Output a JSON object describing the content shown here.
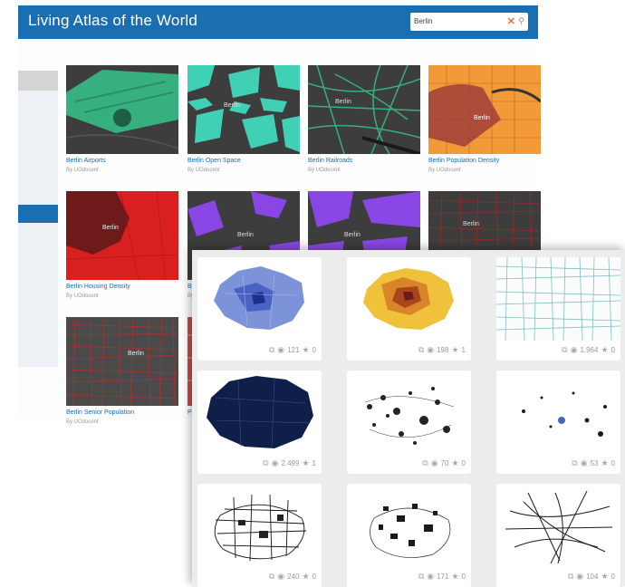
{
  "header": {
    "title": "Living Atlas of the World",
    "search_value": "Berlin",
    "clear_icon": "close-icon",
    "search_icon": "search-icon"
  },
  "gallery_back": [
    {
      "title": "Berlin Airports",
      "owner": "By UOdocent",
      "map_label": ""
    },
    {
      "title": "Berlin Open Space",
      "owner": "By UOdocent",
      "map_label": "Berlin"
    },
    {
      "title": "Berlin Railroads",
      "owner": "By UOdocent",
      "map_label": "Berlin"
    },
    {
      "title": "Berlin Population Density",
      "owner": "By UOdocent",
      "map_label": "Berlin"
    },
    {
      "title": "Berlin Housing Density",
      "owner": "By UOdocent",
      "map_label": "Berlin"
    },
    {
      "title": "Be",
      "owner": "By",
      "map_label": "Berlin"
    },
    {
      "title": "",
      "owner": "",
      "map_label": "Berlin"
    },
    {
      "title": "",
      "owner": "",
      "map_label": "Berlin"
    },
    {
      "title": "Berlin Senior Population",
      "owner": "By UOdocent",
      "map_label": "Berlin"
    },
    {
      "title": "Po",
      "owner": "",
      "map_label": ""
    }
  ],
  "gallery_front": [
    {
      "views": "121",
      "favorites": "0"
    },
    {
      "views": "198",
      "favorites": "1"
    },
    {
      "views": "1.964",
      "favorites": "0"
    },
    {
      "views": "2.499",
      "favorites": "1"
    },
    {
      "views": "70",
      "favorites": "0"
    },
    {
      "views": "53",
      "favorites": "0"
    },
    {
      "views": "240",
      "favorites": "0"
    },
    {
      "views": "171",
      "favorites": "0"
    },
    {
      "views": "104",
      "favorites": "0"
    }
  ],
  "colors": {
    "header_blue": "#1a6fb3",
    "link_blue": "#1a6fb3",
    "dark_map": "#3d3d3d",
    "airport_green": "#35b07e",
    "open_space_teal": "#3fd0b6",
    "population_orange": "#f29a38",
    "housing_red": "#d91f1f",
    "purple": "#8a46e4"
  },
  "icons": {
    "share": "external-link-icon",
    "views": "eye-icon",
    "favorites": "star-icon"
  }
}
